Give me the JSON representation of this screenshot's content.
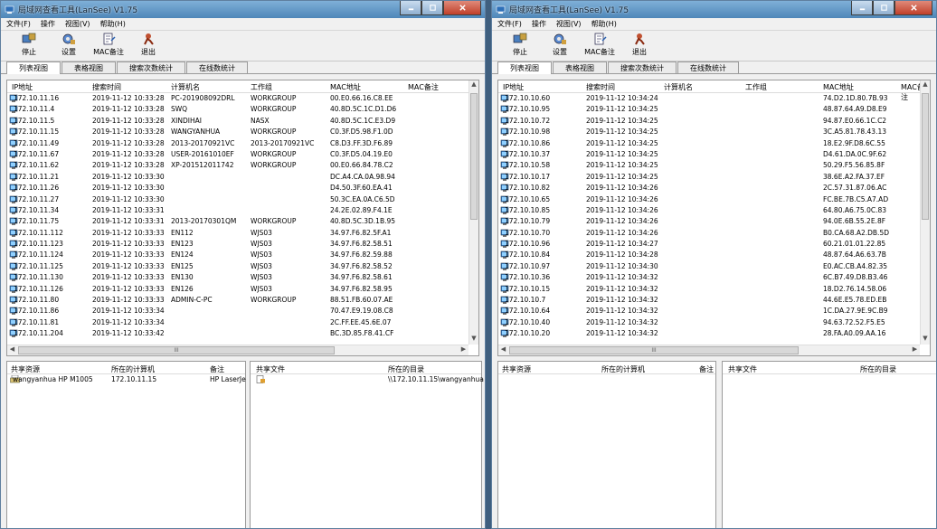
{
  "left": {
    "title": "局域网查看工具(LanSee) V1.75",
    "menu": [
      "文件(F)",
      "操作",
      "视图(V)",
      "帮助(H)"
    ],
    "toolbar": {
      "stop": "停止",
      "settings": "设置",
      "mac_note": "MAC备注",
      "exit": "退出"
    },
    "tabs": [
      "列表视图",
      "表格视图",
      "搜索次数统计",
      "在线数统计"
    ],
    "columns": [
      "IP地址",
      "搜索时间",
      "计算机名",
      "工作组",
      "MAC地址",
      "MAC备注"
    ],
    "rows": [
      [
        "172.10.11.16",
        "2019-11-12 10:33:28",
        "PC-201908092DRL",
        "WORKGROUP",
        "00.E0.66.16.C8.EE"
      ],
      [
        "172.10.11.4",
        "2019-11-12 10:33:28",
        "SWQ",
        "WORKGROUP",
        "40.8D.5C.1C.D1.D6"
      ],
      [
        "172.10.11.5",
        "2019-11-12 10:33:28",
        "XINDIHAI",
        "NASX",
        "40.8D.5C.1C.E3.D9"
      ],
      [
        "172.10.11.15",
        "2019-11-12 10:33:28",
        "WANGYANHUA",
        "WORKGROUP",
        "C0.3F.D5.98.F1.0D"
      ],
      [
        "172.10.11.49",
        "2019-11-12 10:33:28",
        "2013-20170921VC",
        "2013-20170921VC",
        "C8.D3.FF.3D.F6.89"
      ],
      [
        "172.10.11.67",
        "2019-11-12 10:33:28",
        "USER-20161010EF",
        "WORKGROUP",
        "C0.3F.D5.04.19.E0"
      ],
      [
        "172.10.11.62",
        "2019-11-12 10:33:28",
        "XP-201512011742",
        "WORKGROUP",
        "00.E0.66.84.78.C2"
      ],
      [
        "172.10.11.21",
        "2019-11-12 10:33:30",
        "",
        "",
        "DC.A4.CA.0A.98.94"
      ],
      [
        "172.10.11.26",
        "2019-11-12 10:33:30",
        "",
        "",
        "D4.50.3F.60.EA.41"
      ],
      [
        "172.10.11.27",
        "2019-11-12 10:33:30",
        "",
        "",
        "50.3C.EA.0A.C6.5D"
      ],
      [
        "172.10.11.34",
        "2019-11-12 10:33:31",
        "",
        "",
        "24.2E.02.89.F4.1E"
      ],
      [
        "172.10.11.75",
        "2019-11-12 10:33:31",
        "2013-20170301QM",
        "WORKGROUP",
        "40.8D.5C.3D.1B.95"
      ],
      [
        "172.10.11.112",
        "2019-11-12 10:33:33",
        "EN112",
        "WJS03",
        "34.97.F6.82.5F.A1"
      ],
      [
        "172.10.11.123",
        "2019-11-12 10:33:33",
        "EN123",
        "WJS03",
        "34.97.F6.82.58.51"
      ],
      [
        "172.10.11.124",
        "2019-11-12 10:33:33",
        "EN124",
        "WJS03",
        "34.97.F6.82.59.88"
      ],
      [
        "172.10.11.125",
        "2019-11-12 10:33:33",
        "EN125",
        "WJS03",
        "34.97.F6.82.58.52"
      ],
      [
        "172.10.11.130",
        "2019-11-12 10:33:33",
        "EN130",
        "WJS03",
        "34.97.F6.82.58.61"
      ],
      [
        "172.10.11.126",
        "2019-11-12 10:33:33",
        "EN126",
        "WJS03",
        "34.97.F6.82.58.95"
      ],
      [
        "172.10.11.80",
        "2019-11-12 10:33:33",
        "ADMIN-C-PC",
        "WORKGROUP",
        "88.51.FB.60.07.AE"
      ],
      [
        "172.10.11.86",
        "2019-11-12 10:33:34",
        "",
        "",
        "70.47.E9.19.08.C8"
      ],
      [
        "172.10.11.81",
        "2019-11-12 10:33:34",
        "",
        "",
        "2C.FF.EE.45.6E.07"
      ],
      [
        "172.10.11.204",
        "2019-11-12 10:33:42",
        "",
        "",
        "BC.3D.85.F8.41.CF"
      ]
    ],
    "share_cols": [
      "共享资源",
      "所在的计算机",
      "备注"
    ],
    "share_row": [
      "wangyanhua HP M1005",
      "172.10.11.15",
      "HP LaserJe"
    ],
    "file_cols": [
      "共享文件",
      "所在的目录"
    ],
    "file_row": [
      "\\\\172.10.11.15\\wangyanhua"
    ],
    "hscroll_mark": "III"
  },
  "right": {
    "title": "局域网查看工具(LanSee) V1.75",
    "menu": [
      "文件(F)",
      "操作",
      "视图(V)",
      "帮助(H)"
    ],
    "toolbar": {
      "stop": "停止",
      "settings": "设置",
      "mac_note": "MAC备注",
      "exit": "退出"
    },
    "tabs": [
      "列表视图",
      "表格视图",
      "搜索次数统计",
      "在线数统计"
    ],
    "columns": [
      "IP地址",
      "搜索时间",
      "计算机名",
      "工作组",
      "MAC地址",
      "MAC备注"
    ],
    "rows": [
      [
        "172.10.10.60",
        "2019-11-12 10:34:24",
        "",
        "",
        "74.D2.1D.80.7B.93"
      ],
      [
        "172.10.10.95",
        "2019-11-12 10:34:25",
        "",
        "",
        "48.87.64.A9.D8.E9"
      ],
      [
        "172.10.10.72",
        "2019-11-12 10:34:25",
        "",
        "",
        "94.87.E0.66.1C.C2"
      ],
      [
        "172.10.10.98",
        "2019-11-12 10:34:25",
        "",
        "",
        "3C.A5.81.78.43.13"
      ],
      [
        "172.10.10.86",
        "2019-11-12 10:34:25",
        "",
        "",
        "18.E2.9F.D8.6C.55"
      ],
      [
        "172.10.10.37",
        "2019-11-12 10:34:25",
        "",
        "",
        "D4.61.DA.0C.9F.62"
      ],
      [
        "172.10.10.58",
        "2019-11-12 10:34:25",
        "",
        "",
        "50.29.F5.56.85.8F"
      ],
      [
        "172.10.10.17",
        "2019-11-12 10:34:25",
        "",
        "",
        "38.6E.A2.FA.37.EF"
      ],
      [
        "172.10.10.82",
        "2019-11-12 10:34:26",
        "",
        "",
        "2C.57.31.87.06.AC"
      ],
      [
        "172.10.10.65",
        "2019-11-12 10:34:26",
        "",
        "",
        "FC.BE.7B.C5.A7.AD"
      ],
      [
        "172.10.10.85",
        "2019-11-12 10:34:26",
        "",
        "",
        "64.80.A6.75.0C.83"
      ],
      [
        "172.10.10.79",
        "2019-11-12 10:34:26",
        "",
        "",
        "94.0E.6B.55.2E.8F"
      ],
      [
        "172.10.10.70",
        "2019-11-12 10:34:26",
        "",
        "",
        "B0.CA.68.A2.DB.5D"
      ],
      [
        "172.10.10.96",
        "2019-11-12 10:34:27",
        "",
        "",
        "60.21.01.01.22.85"
      ],
      [
        "172.10.10.84",
        "2019-11-12 10:34:28",
        "",
        "",
        "48.87.64.A6.63.7B"
      ],
      [
        "172.10.10.97",
        "2019-11-12 10:34:30",
        "",
        "",
        "E0.AC.CB.A4.82.35"
      ],
      [
        "172.10.10.36",
        "2019-11-12 10:34:32",
        "",
        "",
        "6C.B7.49.D8.B3.46"
      ],
      [
        "172.10.10.15",
        "2019-11-12 10:34:32",
        "",
        "",
        "18.D2.76.14.58.06"
      ],
      [
        "172.10.10.7",
        "2019-11-12 10:34:32",
        "",
        "",
        "44.6E.E5.78.ED.EB"
      ],
      [
        "172.10.10.64",
        "2019-11-12 10:34:32",
        "",
        "",
        "1C.DA.27.9E.9C.B9"
      ],
      [
        "172.10.10.40",
        "2019-11-12 10:34:32",
        "",
        "",
        "94.63.72.52.F5.E5"
      ],
      [
        "172.10.10.20",
        "2019-11-12 10:34:32",
        "",
        "",
        "28.FA.A0.09.AA.16"
      ]
    ],
    "share_cols": [
      "共享资源",
      "所在的计算机",
      "备注"
    ],
    "file_cols": [
      "共享文件",
      "所在的目录"
    ],
    "hscroll_mark": "III"
  }
}
